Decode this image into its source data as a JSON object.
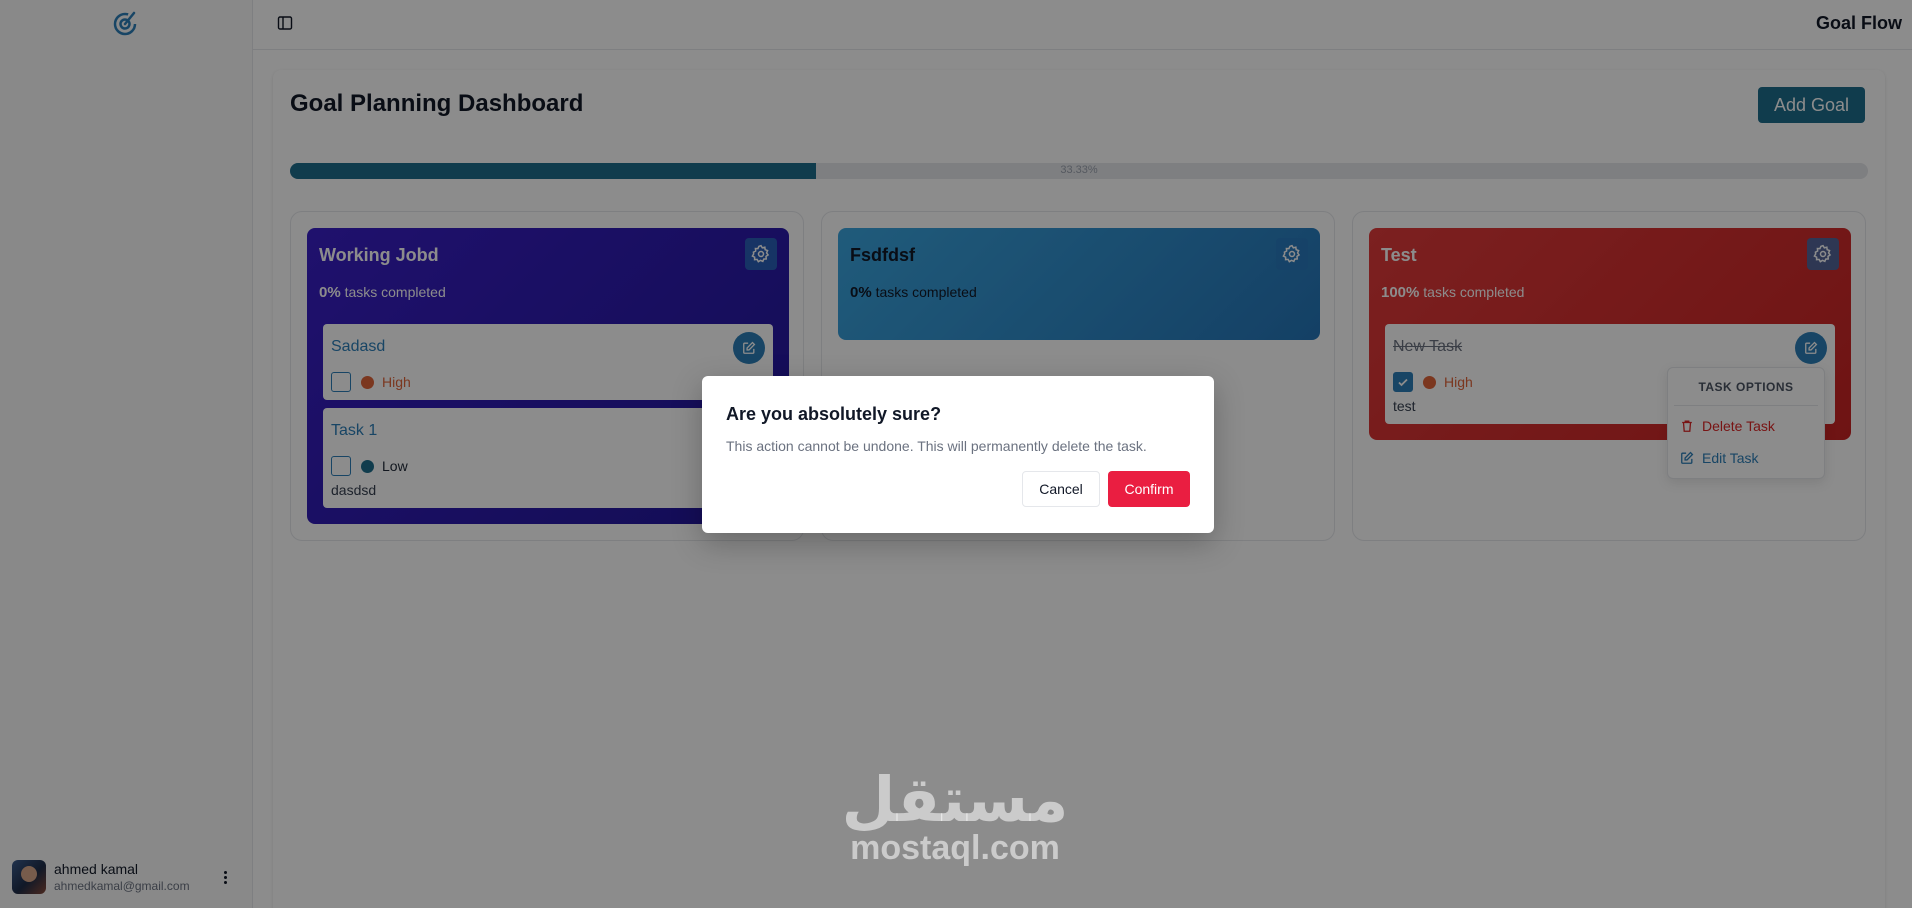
{
  "app": {
    "title": "Goal Flow"
  },
  "user": {
    "name": "ahmed kamal",
    "email": "ahmedkamal@gmail.com"
  },
  "page": {
    "title": "Goal Planning Dashboard",
    "add_goal_label": "Add Goal"
  },
  "progress": {
    "label": "33.33%",
    "value": 33.33
  },
  "goals": [
    {
      "title": "Working Jobd",
      "percent": "0%",
      "stats_text": "tasks completed",
      "color": "#2c1db0",
      "tasks": [
        {
          "title": "Sadasd",
          "priority": "High",
          "priority_color": "#e0643a",
          "completed": false,
          "description": ""
        },
        {
          "title": "Task 1",
          "priority": "Low",
          "priority_color": "#1e6e8c",
          "completed": false,
          "description": "dasdsd"
        }
      ]
    },
    {
      "title": "Fsdfdsf",
      "percent": "0%",
      "stats_text": "tasks completed",
      "color": "#2e8fcf",
      "tasks": []
    },
    {
      "title": "Test",
      "percent": "100%",
      "stats_text": "tasks completed",
      "color": "#cc2a2a",
      "tasks": [
        {
          "title": "New Task",
          "priority": "High",
          "priority_color": "#e0643a",
          "completed": true,
          "description": "test"
        }
      ]
    }
  ],
  "task_menu": {
    "header": "TASK OPTIONS",
    "delete_label": "Delete Task",
    "edit_label": "Edit Task"
  },
  "dialog": {
    "title": "Are you absolutely sure?",
    "description": "This action cannot be undone. This will permanently delete the task.",
    "cancel_label": "Cancel",
    "confirm_label": "Confirm"
  },
  "watermark": {
    "arabic": "مستقل",
    "latin": "mostaql.com"
  }
}
